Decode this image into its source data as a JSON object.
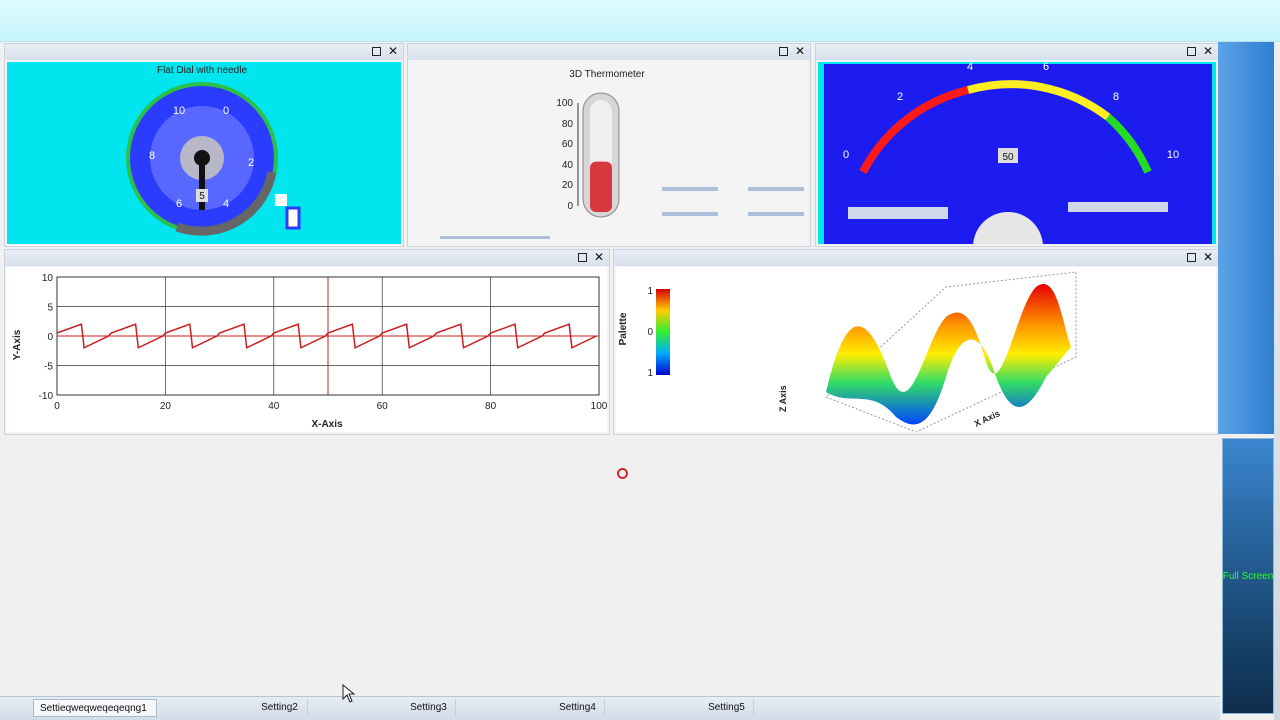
{
  "panels": {
    "dial": {
      "title": "Flat Dial with needle",
      "ticks": [
        "10",
        "0",
        "8",
        "2",
        "6",
        "4",
        "5"
      ]
    },
    "thermometer": {
      "title": "3D Thermometer",
      "scale": [
        "100",
        "80",
        "60",
        "40",
        "20",
        "0"
      ],
      "level_percent": 45
    },
    "gauge": {
      "ticks": [
        "0",
        "2",
        "4",
        "6",
        "8",
        "10"
      ],
      "center_value": "50"
    },
    "line_chart": {
      "ylabel": "Y-Axis",
      "xlabel": "X-Axis",
      "yticks": [
        "10",
        "5",
        "0",
        "-5",
        "-10"
      ],
      "xticks": [
        "0",
        "20",
        "40",
        "60",
        "80",
        "100"
      ]
    },
    "surface": {
      "palette_label": "Palette",
      "palette_ticks": [
        "1",
        "0",
        "1"
      ],
      "z_axis_label": "Z Axis",
      "x_axis_label": "X Axis"
    }
  },
  "side": {
    "full_screen_label": "Full Screen"
  },
  "tabs": [
    {
      "label": "Settieqweqweqeqeqng1"
    },
    {
      "label": "Setting2"
    },
    {
      "label": "Setting3"
    },
    {
      "label": "Setting4"
    },
    {
      "label": "Setting5"
    }
  ],
  "colors": {
    "dial_bg": "#00e5ee",
    "dial_face": "#2b3cff",
    "gauge_bg": "#1c1cf0",
    "line_series": "#cc1f1f",
    "thermo_fill": "#d7373f"
  },
  "chart_data": {
    "type": "line",
    "xlim": [
      0,
      100
    ],
    "ylim": [
      -10,
      10
    ],
    "xlabel": "X-Axis",
    "ylabel": "Y-Axis",
    "grid": true,
    "series": [
      {
        "x": [
          0,
          4.5,
          5,
          9.5,
          10,
          14.5,
          15,
          19.5,
          20,
          24.5,
          25,
          29.5,
          30,
          34.5,
          35,
          39.5,
          40,
          44.5,
          45,
          49.5,
          50,
          54.5,
          55,
          59.5,
          60,
          64.5,
          65,
          69.5,
          70,
          74.5,
          75,
          79.5,
          80,
          84.5,
          85,
          89.5,
          90,
          94.5,
          95,
          99.5
        ],
        "y": [
          0.5,
          2,
          -2,
          0,
          0.5,
          2,
          -2,
          0,
          0.5,
          2,
          -2,
          0,
          0.5,
          2,
          -2,
          0,
          0.5,
          2,
          -2,
          0,
          0.5,
          2,
          -2,
          0,
          0.5,
          2,
          -2,
          0,
          0.5,
          2,
          -2,
          0,
          0.5,
          2,
          -2,
          0,
          0.5,
          2,
          -2,
          0
        ]
      }
    ]
  }
}
